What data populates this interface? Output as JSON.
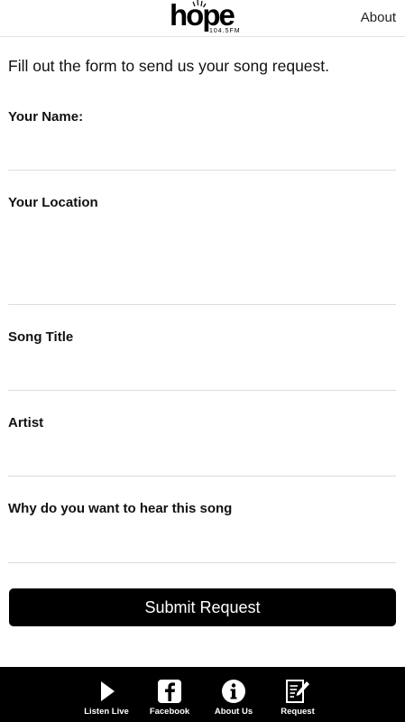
{
  "header": {
    "logo_word": "hope",
    "logo_sub": "104.5FM",
    "about_label": "About"
  },
  "intro": "Fill out the form to send us your song request.",
  "form": {
    "fields": [
      {
        "label": "Your Name:",
        "value": ""
      },
      {
        "label": "Your Location",
        "value": ""
      },
      {
        "label": "Song Title",
        "value": ""
      },
      {
        "label": "Artist",
        "value": ""
      },
      {
        "label": "Why do you want to hear this song",
        "value": ""
      }
    ],
    "submit_label": "Submit Request"
  },
  "tabbar": {
    "items": [
      {
        "label": "Listen Live",
        "icon": "play-icon"
      },
      {
        "label": "Facebook",
        "icon": "facebook-icon"
      },
      {
        "label": "About Us",
        "icon": "info-icon"
      },
      {
        "label": "Request",
        "icon": "edit-note-icon"
      }
    ]
  }
}
